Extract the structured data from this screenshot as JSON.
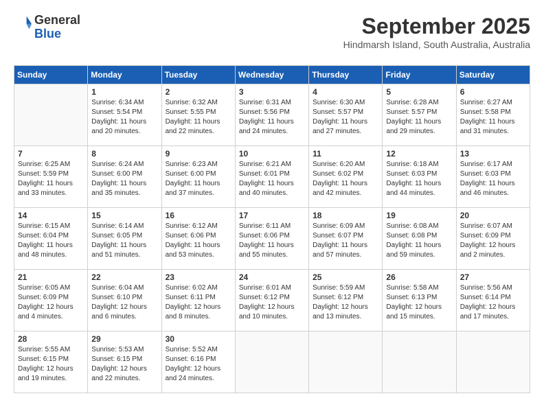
{
  "logo": {
    "line1": "General",
    "line2": "Blue"
  },
  "title": "September 2025",
  "subtitle": "Hindmarsh Island, South Australia, Australia",
  "weekdays": [
    "Sunday",
    "Monday",
    "Tuesday",
    "Wednesday",
    "Thursday",
    "Friday",
    "Saturday"
  ],
  "weeks": [
    [
      {
        "day": "",
        "sunrise": "",
        "sunset": "",
        "daylight": ""
      },
      {
        "day": "1",
        "sunrise": "Sunrise: 6:34 AM",
        "sunset": "Sunset: 5:54 PM",
        "daylight": "Daylight: 11 hours and 20 minutes."
      },
      {
        "day": "2",
        "sunrise": "Sunrise: 6:32 AM",
        "sunset": "Sunset: 5:55 PM",
        "daylight": "Daylight: 11 hours and 22 minutes."
      },
      {
        "day": "3",
        "sunrise": "Sunrise: 6:31 AM",
        "sunset": "Sunset: 5:56 PM",
        "daylight": "Daylight: 11 hours and 24 minutes."
      },
      {
        "day": "4",
        "sunrise": "Sunrise: 6:30 AM",
        "sunset": "Sunset: 5:57 PM",
        "daylight": "Daylight: 11 hours and 27 minutes."
      },
      {
        "day": "5",
        "sunrise": "Sunrise: 6:28 AM",
        "sunset": "Sunset: 5:57 PM",
        "daylight": "Daylight: 11 hours and 29 minutes."
      },
      {
        "day": "6",
        "sunrise": "Sunrise: 6:27 AM",
        "sunset": "Sunset: 5:58 PM",
        "daylight": "Daylight: 11 hours and 31 minutes."
      }
    ],
    [
      {
        "day": "7",
        "sunrise": "Sunrise: 6:25 AM",
        "sunset": "Sunset: 5:59 PM",
        "daylight": "Daylight: 11 hours and 33 minutes."
      },
      {
        "day": "8",
        "sunrise": "Sunrise: 6:24 AM",
        "sunset": "Sunset: 6:00 PM",
        "daylight": "Daylight: 11 hours and 35 minutes."
      },
      {
        "day": "9",
        "sunrise": "Sunrise: 6:23 AM",
        "sunset": "Sunset: 6:00 PM",
        "daylight": "Daylight: 11 hours and 37 minutes."
      },
      {
        "day": "10",
        "sunrise": "Sunrise: 6:21 AM",
        "sunset": "Sunset: 6:01 PM",
        "daylight": "Daylight: 11 hours and 40 minutes."
      },
      {
        "day": "11",
        "sunrise": "Sunrise: 6:20 AM",
        "sunset": "Sunset: 6:02 PM",
        "daylight": "Daylight: 11 hours and 42 minutes."
      },
      {
        "day": "12",
        "sunrise": "Sunrise: 6:18 AM",
        "sunset": "Sunset: 6:03 PM",
        "daylight": "Daylight: 11 hours and 44 minutes."
      },
      {
        "day": "13",
        "sunrise": "Sunrise: 6:17 AM",
        "sunset": "Sunset: 6:03 PM",
        "daylight": "Daylight: 11 hours and 46 minutes."
      }
    ],
    [
      {
        "day": "14",
        "sunrise": "Sunrise: 6:15 AM",
        "sunset": "Sunset: 6:04 PM",
        "daylight": "Daylight: 11 hours and 48 minutes."
      },
      {
        "day": "15",
        "sunrise": "Sunrise: 6:14 AM",
        "sunset": "Sunset: 6:05 PM",
        "daylight": "Daylight: 11 hours and 51 minutes."
      },
      {
        "day": "16",
        "sunrise": "Sunrise: 6:12 AM",
        "sunset": "Sunset: 6:06 PM",
        "daylight": "Daylight: 11 hours and 53 minutes."
      },
      {
        "day": "17",
        "sunrise": "Sunrise: 6:11 AM",
        "sunset": "Sunset: 6:06 PM",
        "daylight": "Daylight: 11 hours and 55 minutes."
      },
      {
        "day": "18",
        "sunrise": "Sunrise: 6:09 AM",
        "sunset": "Sunset: 6:07 PM",
        "daylight": "Daylight: 11 hours and 57 minutes."
      },
      {
        "day": "19",
        "sunrise": "Sunrise: 6:08 AM",
        "sunset": "Sunset: 6:08 PM",
        "daylight": "Daylight: 11 hours and 59 minutes."
      },
      {
        "day": "20",
        "sunrise": "Sunrise: 6:07 AM",
        "sunset": "Sunset: 6:09 PM",
        "daylight": "Daylight: 12 hours and 2 minutes."
      }
    ],
    [
      {
        "day": "21",
        "sunrise": "Sunrise: 6:05 AM",
        "sunset": "Sunset: 6:09 PM",
        "daylight": "Daylight: 12 hours and 4 minutes."
      },
      {
        "day": "22",
        "sunrise": "Sunrise: 6:04 AM",
        "sunset": "Sunset: 6:10 PM",
        "daylight": "Daylight: 12 hours and 6 minutes."
      },
      {
        "day": "23",
        "sunrise": "Sunrise: 6:02 AM",
        "sunset": "Sunset: 6:11 PM",
        "daylight": "Daylight: 12 hours and 8 minutes."
      },
      {
        "day": "24",
        "sunrise": "Sunrise: 6:01 AM",
        "sunset": "Sunset: 6:12 PM",
        "daylight": "Daylight: 12 hours and 10 minutes."
      },
      {
        "day": "25",
        "sunrise": "Sunrise: 5:59 AM",
        "sunset": "Sunset: 6:12 PM",
        "daylight": "Daylight: 12 hours and 13 minutes."
      },
      {
        "day": "26",
        "sunrise": "Sunrise: 5:58 AM",
        "sunset": "Sunset: 6:13 PM",
        "daylight": "Daylight: 12 hours and 15 minutes."
      },
      {
        "day": "27",
        "sunrise": "Sunrise: 5:56 AM",
        "sunset": "Sunset: 6:14 PM",
        "daylight": "Daylight: 12 hours and 17 minutes."
      }
    ],
    [
      {
        "day": "28",
        "sunrise": "Sunrise: 5:55 AM",
        "sunset": "Sunset: 6:15 PM",
        "daylight": "Daylight: 12 hours and 19 minutes."
      },
      {
        "day": "29",
        "sunrise": "Sunrise: 5:53 AM",
        "sunset": "Sunset: 6:15 PM",
        "daylight": "Daylight: 12 hours and 22 minutes."
      },
      {
        "day": "30",
        "sunrise": "Sunrise: 5:52 AM",
        "sunset": "Sunset: 6:16 PM",
        "daylight": "Daylight: 12 hours and 24 minutes."
      },
      {
        "day": "",
        "sunrise": "",
        "sunset": "",
        "daylight": ""
      },
      {
        "day": "",
        "sunrise": "",
        "sunset": "",
        "daylight": ""
      },
      {
        "day": "",
        "sunrise": "",
        "sunset": "",
        "daylight": ""
      },
      {
        "day": "",
        "sunrise": "",
        "sunset": "",
        "daylight": ""
      }
    ]
  ]
}
